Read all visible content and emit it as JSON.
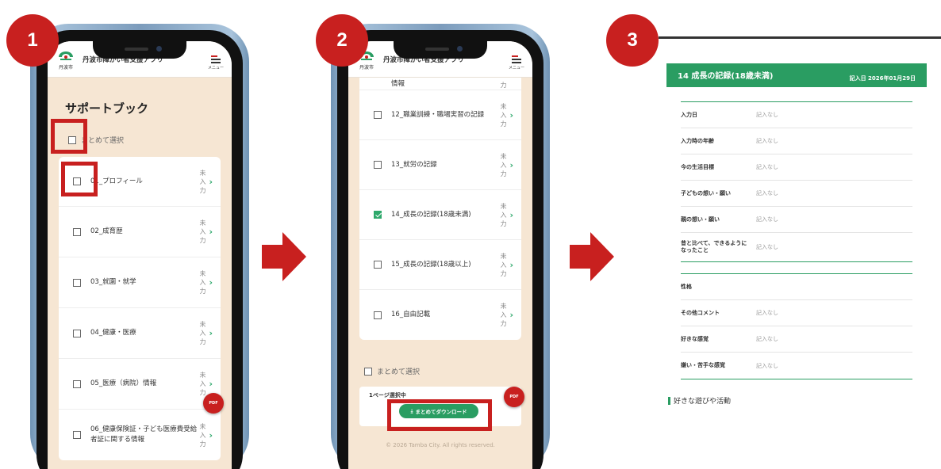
{
  "steps": [
    "1",
    "2",
    "3"
  ],
  "app": {
    "title": "丹波市障がい者支援アプリ",
    "logo_text": "丹波市",
    "menu_label": "メニュー"
  },
  "phone1": {
    "page_title": "サポートブック",
    "select_all": "まとめて選択",
    "status": [
      "未",
      "入",
      "力"
    ],
    "items": [
      {
        "label": "01_プロフィール"
      },
      {
        "label": "02_成育歴"
      },
      {
        "label": "03_就園・就学"
      },
      {
        "label": "04_健康・医療"
      },
      {
        "label": "05_医療（病院）情報"
      },
      {
        "label": "06_健康保険証・子ども医療費受給者証に関する情報"
      }
    ],
    "pdf": "PDF"
  },
  "phone2": {
    "top_partial": "情報",
    "items": [
      {
        "label": "12_職業訓練・職場実習の記録",
        "checked": false
      },
      {
        "label": "13_就労の記録",
        "checked": false
      },
      {
        "label": "14_成長の記録(18歳未満)",
        "checked": true
      },
      {
        "label": "15_成長の記録(18歳以上)",
        "checked": false
      },
      {
        "label": "16_自由記載",
        "checked": false
      }
    ],
    "select_all": "まとめて選択",
    "selection_count": "1ページ選択中",
    "download_button": "まとめてダウンロード",
    "footer": "© 2026 Tamba City. All rights reserved.",
    "pdf": "PDF"
  },
  "document": {
    "title": "14 成長の記録(18歳未満)",
    "date": "記入日 2026年01月29日",
    "group1": [
      {
        "label": "入力日",
        "value": "記入なし"
      },
      {
        "label": "入力時の年齢",
        "value": "記入なし"
      },
      {
        "label": "今の生活目標",
        "value": "記入なし"
      },
      {
        "label": "子どもの想い・願い",
        "value": "記入なし"
      },
      {
        "label": "親の想い・願い",
        "value": "記入なし"
      },
      {
        "label": "昔と比べて、できるようになったこと",
        "value": "記入なし"
      }
    ],
    "group2": [
      {
        "label": "性格",
        "value": ""
      },
      {
        "label": "その他コメント",
        "value": "記入なし"
      },
      {
        "label": "好きな感覚",
        "value": "記入なし"
      },
      {
        "label": "嫌い・苦手な感覚",
        "value": "記入なし"
      }
    ],
    "next_section": "好きな遊びや活動"
  },
  "colors": {
    "accent_red": "#c8201f",
    "brand_green": "#2a9d62",
    "screen_bg": "#f6e6d3"
  }
}
